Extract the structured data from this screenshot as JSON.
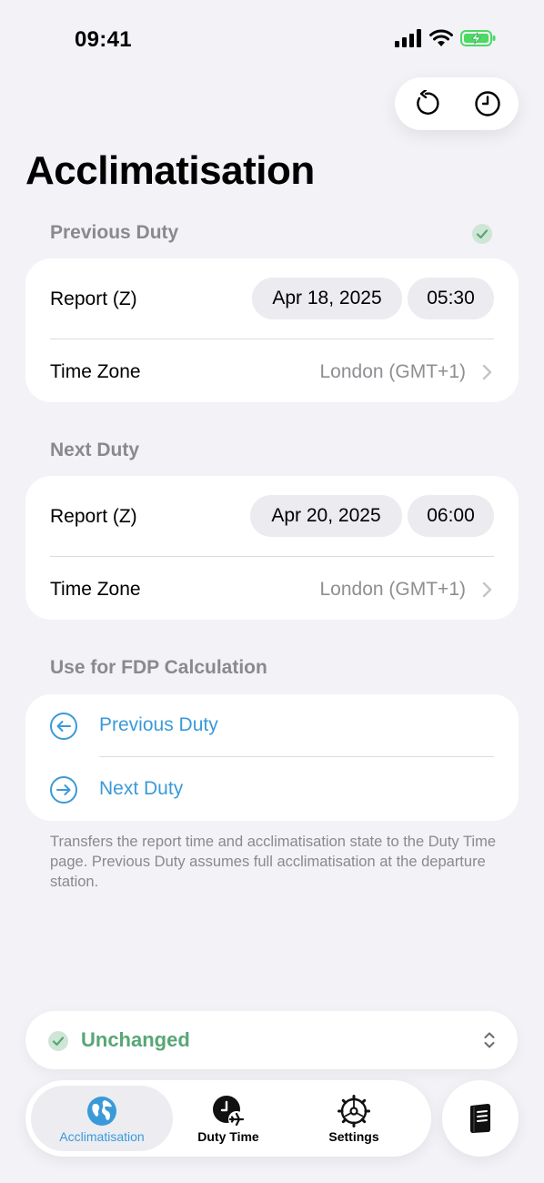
{
  "status_bar": {
    "time": "09:41"
  },
  "header": {
    "title": "Acclimatisation"
  },
  "previous_duty": {
    "section_title": "Previous Duty",
    "report_label": "Report (Z)",
    "report_date": "Apr 18, 2025",
    "report_time": "05:30",
    "timezone_label": "Time Zone",
    "timezone_value": "London (GMT+1)"
  },
  "next_duty": {
    "section_title": "Next Duty",
    "report_label": "Report (Z)",
    "report_date": "Apr 20, 2025",
    "report_time": "06:00",
    "timezone_label": "Time Zone",
    "timezone_value": "London (GMT+1)"
  },
  "fdp": {
    "section_title": "Use for FDP Calculation",
    "previous_label": "Previous Duty",
    "next_label": "Next Duty",
    "footnote": "Transfers the report time and acclimatisation state to the Duty Time page. Previous Duty assumes full acclimatisation at the departure station."
  },
  "status": {
    "label": "Unchanged"
  },
  "tabs": [
    {
      "label": "Acclimatisation",
      "icon": "globe-icon",
      "active": true
    },
    {
      "label": "Duty Time",
      "icon": "clock-plane-icon",
      "active": false
    },
    {
      "label": "Settings",
      "icon": "gear-icon",
      "active": false
    }
  ],
  "colors": {
    "accent": "#3a9ad9",
    "success": "#57a774",
    "background": "#f2f2f7"
  }
}
